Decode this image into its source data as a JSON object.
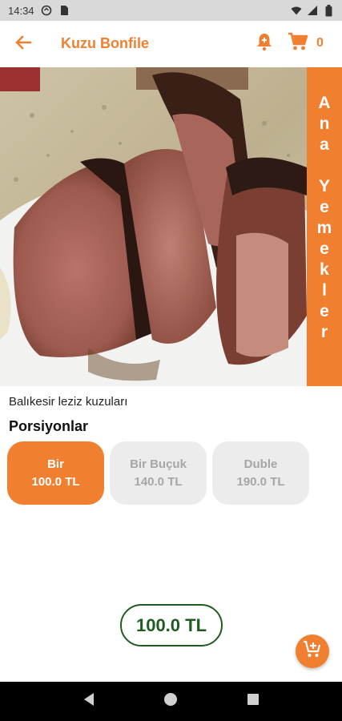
{
  "status_bar": {
    "time": "14:34",
    "icons": [
      "sync-icon",
      "sim-card-icon",
      "wifi-icon",
      "signal-icon",
      "battery-icon"
    ]
  },
  "app_bar": {
    "title": "Kuzu Bonfile",
    "cart_count": "0",
    "icons": [
      "back-arrow-icon",
      "notification-bell-icon",
      "cart-icon"
    ]
  },
  "hero": {
    "category_label": "Ana Yemekler",
    "category_words": [
      "Ana",
      "Yemekler"
    ]
  },
  "product": {
    "description": "Balıkesir leziz kuzuları",
    "portions_title": "Porsiyonlar",
    "portions": [
      {
        "label": "Bir",
        "price": "100.0 TL",
        "selected": true
      },
      {
        "label": "Bir Buçuk",
        "price": "140.0 TL",
        "selected": false
      },
      {
        "label": "Duble",
        "price": "190.0 TL",
        "selected": false
      }
    ],
    "total": "100.0 TL"
  },
  "colors": {
    "accent": "#f08030",
    "total_green": "#1f5c1f",
    "unselected_bg": "#ececec",
    "unselected_text": "#a6a6a6"
  },
  "nav_bar": {
    "icons": [
      "back-triangle-icon",
      "home-circle-icon",
      "recents-square-icon"
    ]
  }
}
